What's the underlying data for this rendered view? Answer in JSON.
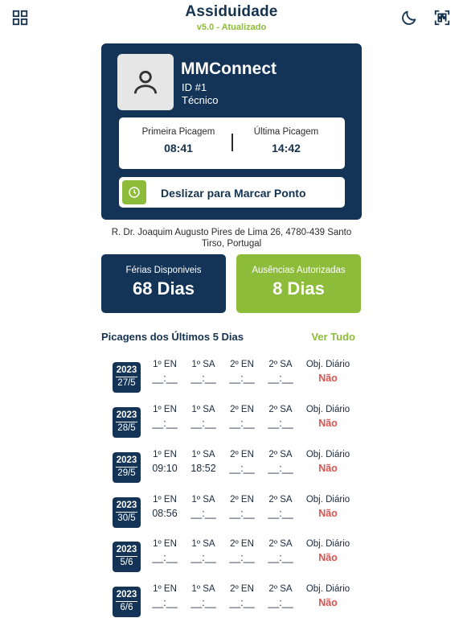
{
  "header": {
    "title": "Assiduidade",
    "version": "v5.0 - Atualizado",
    "icons": [
      "grid-icon",
      "moon-icon",
      "qr-scan-icon"
    ]
  },
  "profile": {
    "name": "MMConnect",
    "id": "ID #1",
    "role": "Técnico",
    "avatar_icon": "person-icon"
  },
  "punch": {
    "first_label": "Primeira Picagem",
    "first_time": "08:41",
    "last_label": "Última Picagem",
    "last_time": "14:42"
  },
  "slide": {
    "label": "Deslizar para Marcar Ponto",
    "icon": "clock-icon"
  },
  "address": "R. Dr. Joaquim Augusto Pires de Lima 26, 4780-439 Santo Tirso, Portugal",
  "stats": {
    "ferias_label": "Férias Disponiveis",
    "ferias_value": "68 Dias",
    "ausencias_label": "Ausências Autorizadas",
    "ausencias_value": "8 Dias"
  },
  "history": {
    "title": "Picagens dos Últimos 5 Dias",
    "see_all": "Ver Tudo",
    "columns": [
      "1º EN",
      "1º SA",
      "2º EN",
      "2º SA",
      "Obj. Diário"
    ],
    "rows": [
      {
        "year": "2023",
        "day": "27/5",
        "values": [
          "__:__",
          "__:__",
          "__:__",
          "__:__"
        ],
        "obj": "Não"
      },
      {
        "year": "2023",
        "day": "28/5",
        "values": [
          "__:__",
          "__:__",
          "__:__",
          "__:__"
        ],
        "obj": "Não"
      },
      {
        "year": "2023",
        "day": "29/5",
        "values": [
          "09:10",
          "18:52",
          "__:__",
          "__:__"
        ],
        "obj": "Não"
      },
      {
        "year": "2023",
        "day": "30/5",
        "values": [
          "08:56",
          "__:__",
          "__:__",
          "__:__"
        ],
        "obj": "Não"
      },
      {
        "year": "2023",
        "day": "5/6",
        "values": [
          "__:__",
          "__:__",
          "__:__",
          "__:__"
        ],
        "obj": "Não"
      },
      {
        "year": "2023",
        "day": "6/6",
        "values": [
          "__:__",
          "__:__",
          "__:__",
          "__:__"
        ],
        "obj": "Não"
      }
    ]
  },
  "colors": {
    "navy": "#143457",
    "green": "#8dbb3a",
    "red": "#d9534f"
  }
}
